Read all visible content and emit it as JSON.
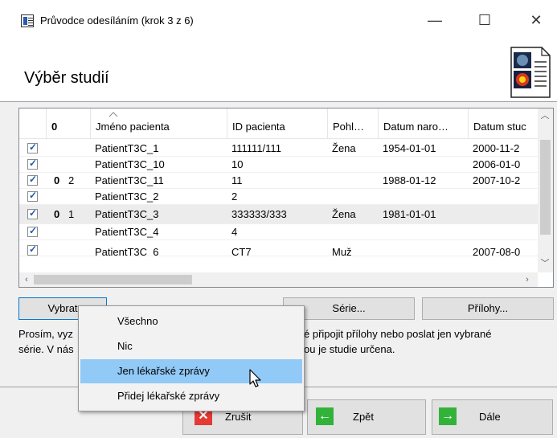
{
  "window": {
    "title": "Průvodce odesíláním (krok 3 z 6)",
    "minimize_glyph": "—",
    "maximize_glyph": "☐",
    "close_glyph": "✕"
  },
  "header": {
    "title": "Výběr studií"
  },
  "table": {
    "columns": [
      "",
      "",
      "Jméno pacienta",
      "ID pacienta",
      "Pohl…",
      "Datum naro…",
      "Datum stuc"
    ],
    "attach_header_glyph": "0",
    "rows": [
      {
        "attach": "",
        "count": "",
        "name": "PatientT3C_1",
        "id": "111111/111",
        "sex": "Žena",
        "birth": "1954-01-01",
        "study": "2000-11-2"
      },
      {
        "attach": "",
        "count": "",
        "name": "PatientT3C_10",
        "id": "10",
        "sex": "",
        "birth": "",
        "study": "2006-01-0"
      },
      {
        "attach": "0",
        "count": "2",
        "name": "PatientT3C_11",
        "id": "11",
        "sex": "",
        "birth": "1988-01-12",
        "study": "2007-10-2"
      },
      {
        "attach": "",
        "count": "",
        "name": "PatientT3C_2",
        "id": "2",
        "sex": "",
        "birth": "",
        "study": ""
      },
      {
        "attach": "0",
        "count": "1",
        "name": "PatientT3C_3",
        "id": "333333/333",
        "sex": "Žena",
        "birth": "1981-01-01",
        "study": ""
      },
      {
        "attach": "",
        "count": "",
        "name": "PatientT3C_4",
        "id": "4",
        "sex": "",
        "birth": "",
        "study": ""
      },
      {
        "attach": "",
        "count": "",
        "name": "PatientT3C_6",
        "id": "CT7",
        "sex": "Muž",
        "birth": "",
        "study": "2007-08-0"
      }
    ]
  },
  "buttons": {
    "select": "Vybrat",
    "series": "Série...",
    "attachments": "Přílohy..."
  },
  "bottom_text": {
    "line1_left": "Prosím, vyz",
    "line1_right": "é připojit přílohy nebo poslat jen vybrané",
    "line2_left": "série. V nás",
    "line2_right": "ou je studie určena."
  },
  "nav": {
    "cancel": "Zrušit",
    "back": "Zpět",
    "next": "Dále"
  },
  "menu": {
    "items": [
      "Všechno",
      "Nic",
      "Jen lékařské zprávy",
      "Přidej lékařské zprávy"
    ],
    "highlighted_index": 2
  },
  "colors": {
    "menu_highlight": "#91c9f7",
    "check": "#1e59b3",
    "cancel_icon": "#e53935",
    "arrow_icon": "#33b23a"
  }
}
